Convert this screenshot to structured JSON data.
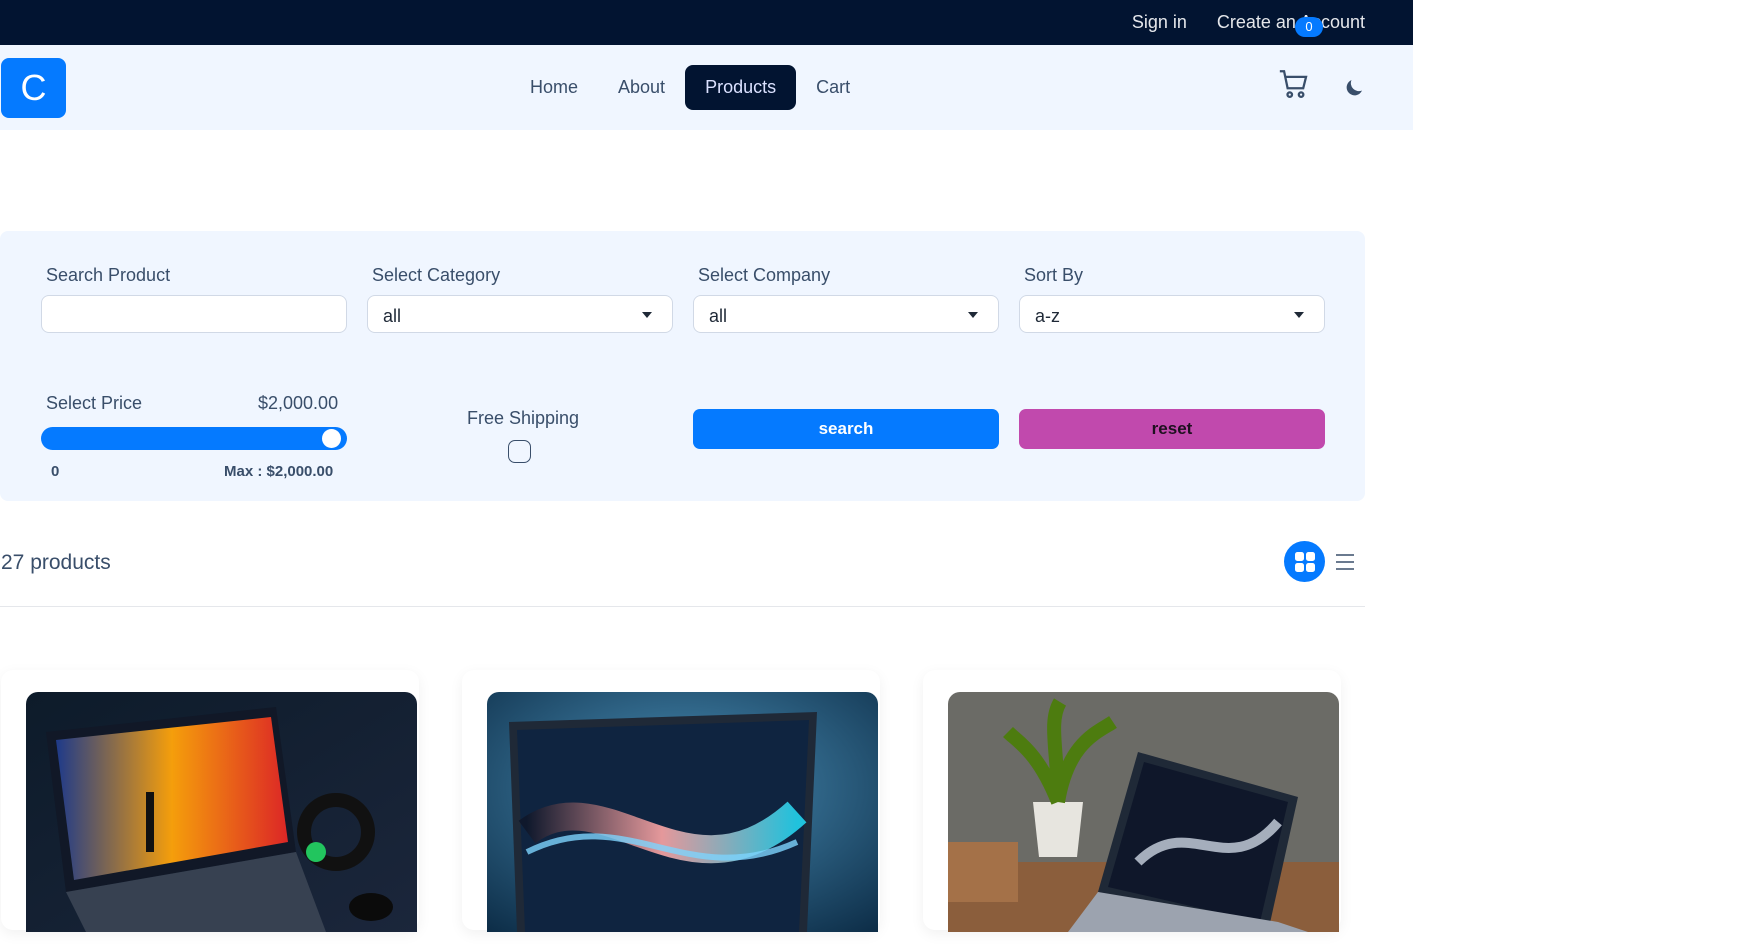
{
  "topbar": {
    "sign_in": "Sign in",
    "create_account": "Create an Account"
  },
  "nav": {
    "logo_letter": "C",
    "items": [
      {
        "label": "Home",
        "active": false
      },
      {
        "label": "About",
        "active": false
      },
      {
        "label": "Products",
        "active": true
      },
      {
        "label": "Cart",
        "active": false
      }
    ],
    "cart_count": "0",
    "icons": {
      "cart": "cart-icon",
      "theme": "moon-icon"
    }
  },
  "filters": {
    "search": {
      "label": "Search Product",
      "value": ""
    },
    "category": {
      "label": "Select Category",
      "value": "all"
    },
    "company": {
      "label": "Select Company",
      "value": "all"
    },
    "sort": {
      "label": "Sort By",
      "value": "a-z"
    },
    "price": {
      "label": "Select Price",
      "value_text": "$2,000.00",
      "min_label": "0",
      "max_label": "Max : $2,000.00",
      "level": 1.0
    },
    "shipping": {
      "label": "Free Shipping",
      "checked": false
    },
    "search_button": "search",
    "reset_button": "reset"
  },
  "results": {
    "count_text": "27 products",
    "view_icons": {
      "grid": "grid-icon",
      "list": "list-icon"
    }
  },
  "colors": {
    "primary": "#057aff",
    "secondary": "#c149ad",
    "dark": "#021431",
    "panel": "#f0f6ff"
  }
}
